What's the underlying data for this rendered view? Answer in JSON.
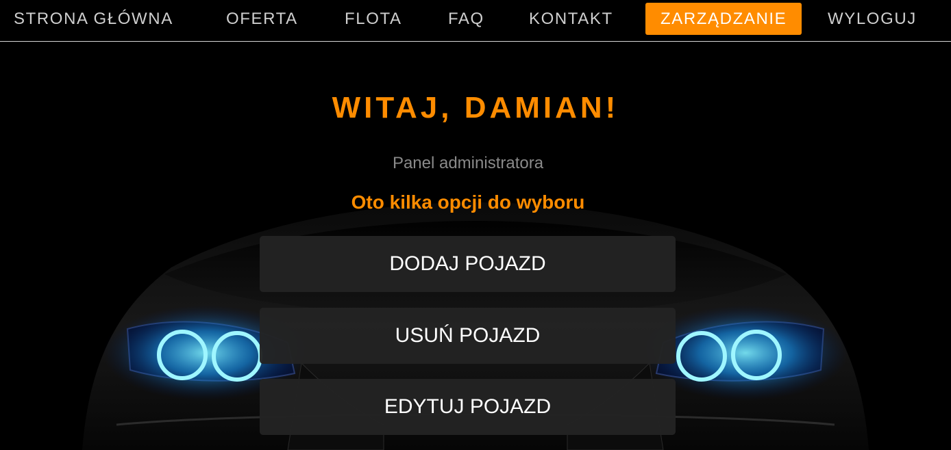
{
  "nav": {
    "items": [
      {
        "label": "STRONA GŁÓWNA"
      },
      {
        "label": "OFERTA"
      },
      {
        "label": "FLOTA"
      },
      {
        "label": "FAQ"
      },
      {
        "label": "KONTAKT"
      },
      {
        "label": "ZARZĄDZANIE"
      },
      {
        "label": "WYLOGUJ"
      }
    ],
    "active_index": 5
  },
  "main": {
    "welcome": "WITAJ, DAMIAN!",
    "subtitle": "Panel administratora",
    "prompt": "Oto kilka opcji do wyboru",
    "actions": [
      {
        "label": "DODAJ POJAZD"
      },
      {
        "label": "USUŃ POJAZD"
      },
      {
        "label": "EDYTUJ POJAZD"
      }
    ]
  },
  "colors": {
    "accent": "#ff8c00",
    "background": "#000000",
    "button_bg": "#232323",
    "nav_text": "#cfcfcf",
    "subtitle_text": "#8a8a8a",
    "headlight_glow": "#33d6ff"
  }
}
